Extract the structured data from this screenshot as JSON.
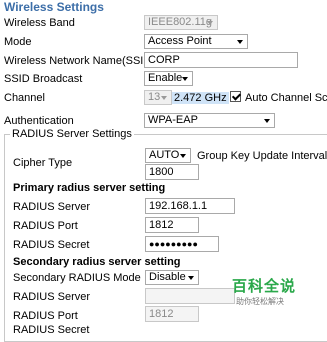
{
  "section_title": "Wireless Settings",
  "rows": {
    "wireless_band": {
      "label": "Wireless Band",
      "value": "IEEE802.11g"
    },
    "mode": {
      "label": "Mode",
      "value": "Access Point"
    },
    "ssid": {
      "label": "Wireless Network Name(SSID)",
      "value": "CORP"
    },
    "ssid_broadcast": {
      "label": "SSID Broadcast",
      "value": "Enable"
    },
    "channel": {
      "label": "Channel",
      "value": "13",
      "freq": "2.472 GHz",
      "auto_scan_label": "Auto Channel Scan",
      "auto_scan_checked": true
    },
    "authentication": {
      "label": "Authentication",
      "value": "WPA-EAP"
    }
  },
  "radius": {
    "legend": "RADIUS Server Settings",
    "cipher_label": "Cipher Type",
    "cipher_value": "AUTO",
    "group_key_label": "Group Key Update Interval",
    "group_key_value": "1800",
    "primary_heading": "Primary radius server setting",
    "primary_server_label": "RADIUS Server",
    "primary_server_value": "192.168.1.1",
    "primary_port_label": "RADIUS Port",
    "primary_port_value": "1812",
    "primary_secret_label": "RADIUS Secret",
    "primary_secret_value": "●●●●●●●●●",
    "secondary_heading": "Secondary radius server setting",
    "secondary_mode_label": "Secondary RADIUS Mode",
    "secondary_mode_value": "Disable",
    "secondary_server_label": "RADIUS Server",
    "secondary_server_value": "",
    "secondary_port_label": "RADIUS Port",
    "secondary_port_value": "1812",
    "secondary_secret_label": "RADIUS Secret"
  },
  "watermark": {
    "title": "百科全说",
    "subtitle": "助你轻松解决"
  },
  "colors": {
    "title": "#3c6ea8",
    "watermark": "#2aa84a",
    "highlight": "#cfe3f7"
  }
}
